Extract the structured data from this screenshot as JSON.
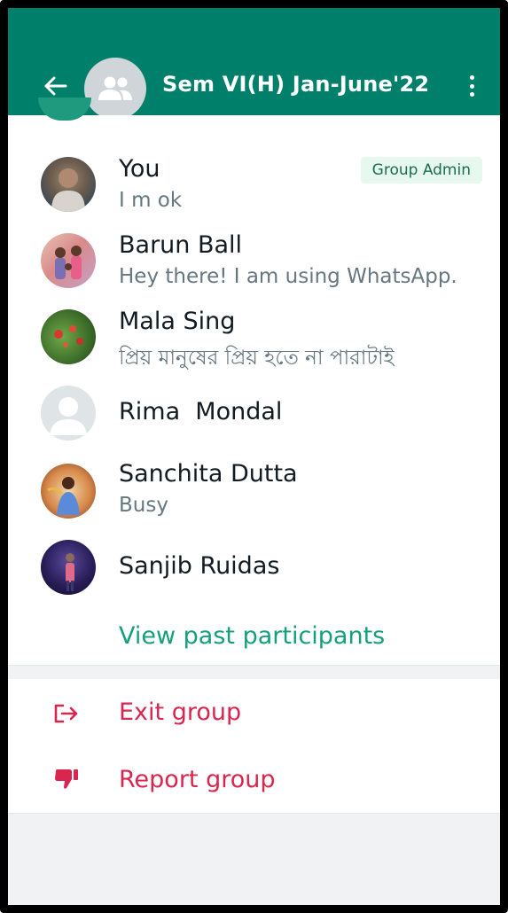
{
  "header": {
    "group_name": "Sem VI(H) Jan-June'22",
    "back_icon": "back-arrow-icon",
    "menu_icon": "more-vertical-icon",
    "avatar_icon": "group-icon"
  },
  "participants": [
    {
      "name": "You",
      "about": "I m ok",
      "badge": "Group Admin"
    },
    {
      "name": "Barun Ball",
      "about": "Hey there! I am using WhatsApp."
    },
    {
      "name": "Mala Sing",
      "about": "প্রিয় মানুষের প্রিয় হতে না পারাটাই"
    },
    {
      "name": "Rima  Mondal",
      "about": ""
    },
    {
      "name": "Sanchita Dutta",
      "about": "Busy"
    },
    {
      "name": "Sanjib Ruidas",
      "about": ""
    }
  ],
  "view_past_label": "View past participants",
  "actions": {
    "exit_label": "Exit group",
    "exit_icon": "exit-icon",
    "report_label": "Report group",
    "report_icon": "thumbs-down-icon"
  },
  "colors": {
    "header_bg": "#00806a",
    "accent_green": "#14a07d",
    "danger_red": "#d9264f",
    "badge_bg": "#e7f8ef"
  }
}
